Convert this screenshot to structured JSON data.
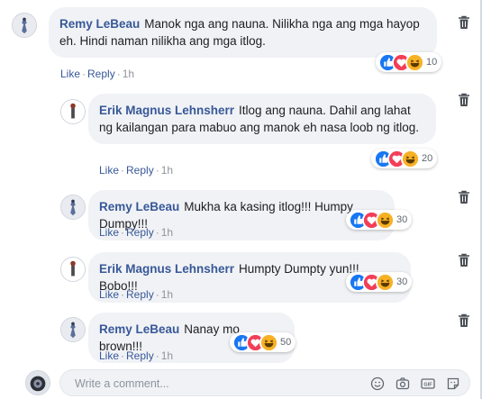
{
  "comments": [
    {
      "author": "Remy LeBeau",
      "text": "Manok nga ang nauna. Nilikha nga ang mga hayop eh. Hindi naman nilikha ang mga itlog.",
      "like": "Like",
      "reply": "Reply",
      "time": "1h",
      "reaction_count": "10",
      "reaction_icons": [
        "like-icon",
        "love-icon",
        "haha-icon"
      ]
    },
    {
      "author": "Erik Magnus Lehnsherr",
      "text": "Itlog ang nauna. Dahil ang lahat ng kailangan para mabuo ang manok eh nasa loob ng itlog.",
      "like": "Like",
      "reply": "Reply",
      "time": "1h",
      "reaction_count": "20",
      "reaction_icons": [
        "like-icon",
        "love-icon",
        "haha-icon"
      ]
    },
    {
      "author": "Remy LeBeau",
      "text": "Mukha ka kasing itlog!!! Humpy Dumpy!!!",
      "like": "Like",
      "reply": "Reply",
      "time": "1h",
      "reaction_count": "30",
      "reaction_icons": [
        "like-icon",
        "love-icon",
        "haha-icon"
      ]
    },
    {
      "author": "Erik Magnus Lehnsherr",
      "text": "Humpty Dumpty yun!!! Bobo!!!",
      "like": "Like",
      "reply": "Reply",
      "time": "1h",
      "reaction_count": "30",
      "reaction_icons": [
        "like-icon",
        "love-icon",
        "haha-icon"
      ]
    },
    {
      "author": "Remy LeBeau",
      "text": "Nanay mo brown!!!",
      "like": "Like",
      "reply": "Reply",
      "time": "1h",
      "reaction_count": "50",
      "reaction_icons": [
        "like-icon",
        "love-icon",
        "haha-icon"
      ]
    }
  ],
  "composer": {
    "placeholder": "Write a comment...",
    "tool_icons": [
      "emoji-icon",
      "camera-icon",
      "gif-icon",
      "sticker-icon"
    ]
  },
  "colors": {
    "author": "#385898",
    "bubble": "#f0f2f5",
    "like_reaction": "#1877f2",
    "love_reaction": "#f33e58",
    "haha_reaction": "#f7b125"
  }
}
